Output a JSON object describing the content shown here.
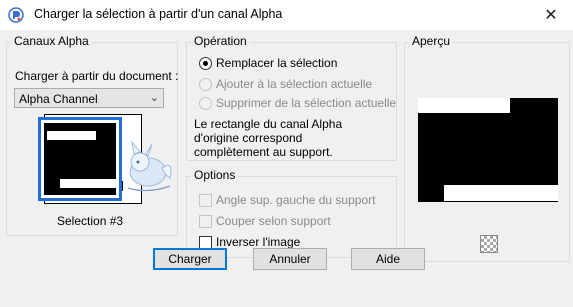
{
  "window": {
    "title": "Charger la sélection à partir d'un canal Alpha",
    "close_glyph": "✕"
  },
  "canaux": {
    "legend": "Canaux Alpha",
    "source_label": "Charger à partir du document :",
    "document_value": "Alpha Channel",
    "selection_label": "Selection #3"
  },
  "operation": {
    "legend": "Opération",
    "options": [
      {
        "label": "Remplacer la sélection",
        "checked": true,
        "enabled": true
      },
      {
        "label": "Ajouter à la sélection actuelle",
        "checked": false,
        "enabled": false
      },
      {
        "label": "Supprimer de la sélection actuelle",
        "checked": false,
        "enabled": false
      }
    ],
    "info_lines": [
      "Le rectangle du canal Alpha",
      "d'origine correspond",
      "complètement au support."
    ]
  },
  "options": {
    "legend": "Options",
    "items": [
      {
        "label": "Angle sup. gauche du support",
        "checked": false,
        "enabled": false
      },
      {
        "label": "Couper selon support",
        "checked": false,
        "enabled": false
      },
      {
        "label": "Inverser l'image",
        "checked": false,
        "enabled": true
      }
    ]
  },
  "apercu": {
    "legend": "Aperçu"
  },
  "buttons": {
    "charger": "Charger",
    "annuler": "Annuler",
    "aide": "Aide"
  },
  "colors": {
    "accent": "#0078d7",
    "thumb_border": "#1e6fd8"
  }
}
